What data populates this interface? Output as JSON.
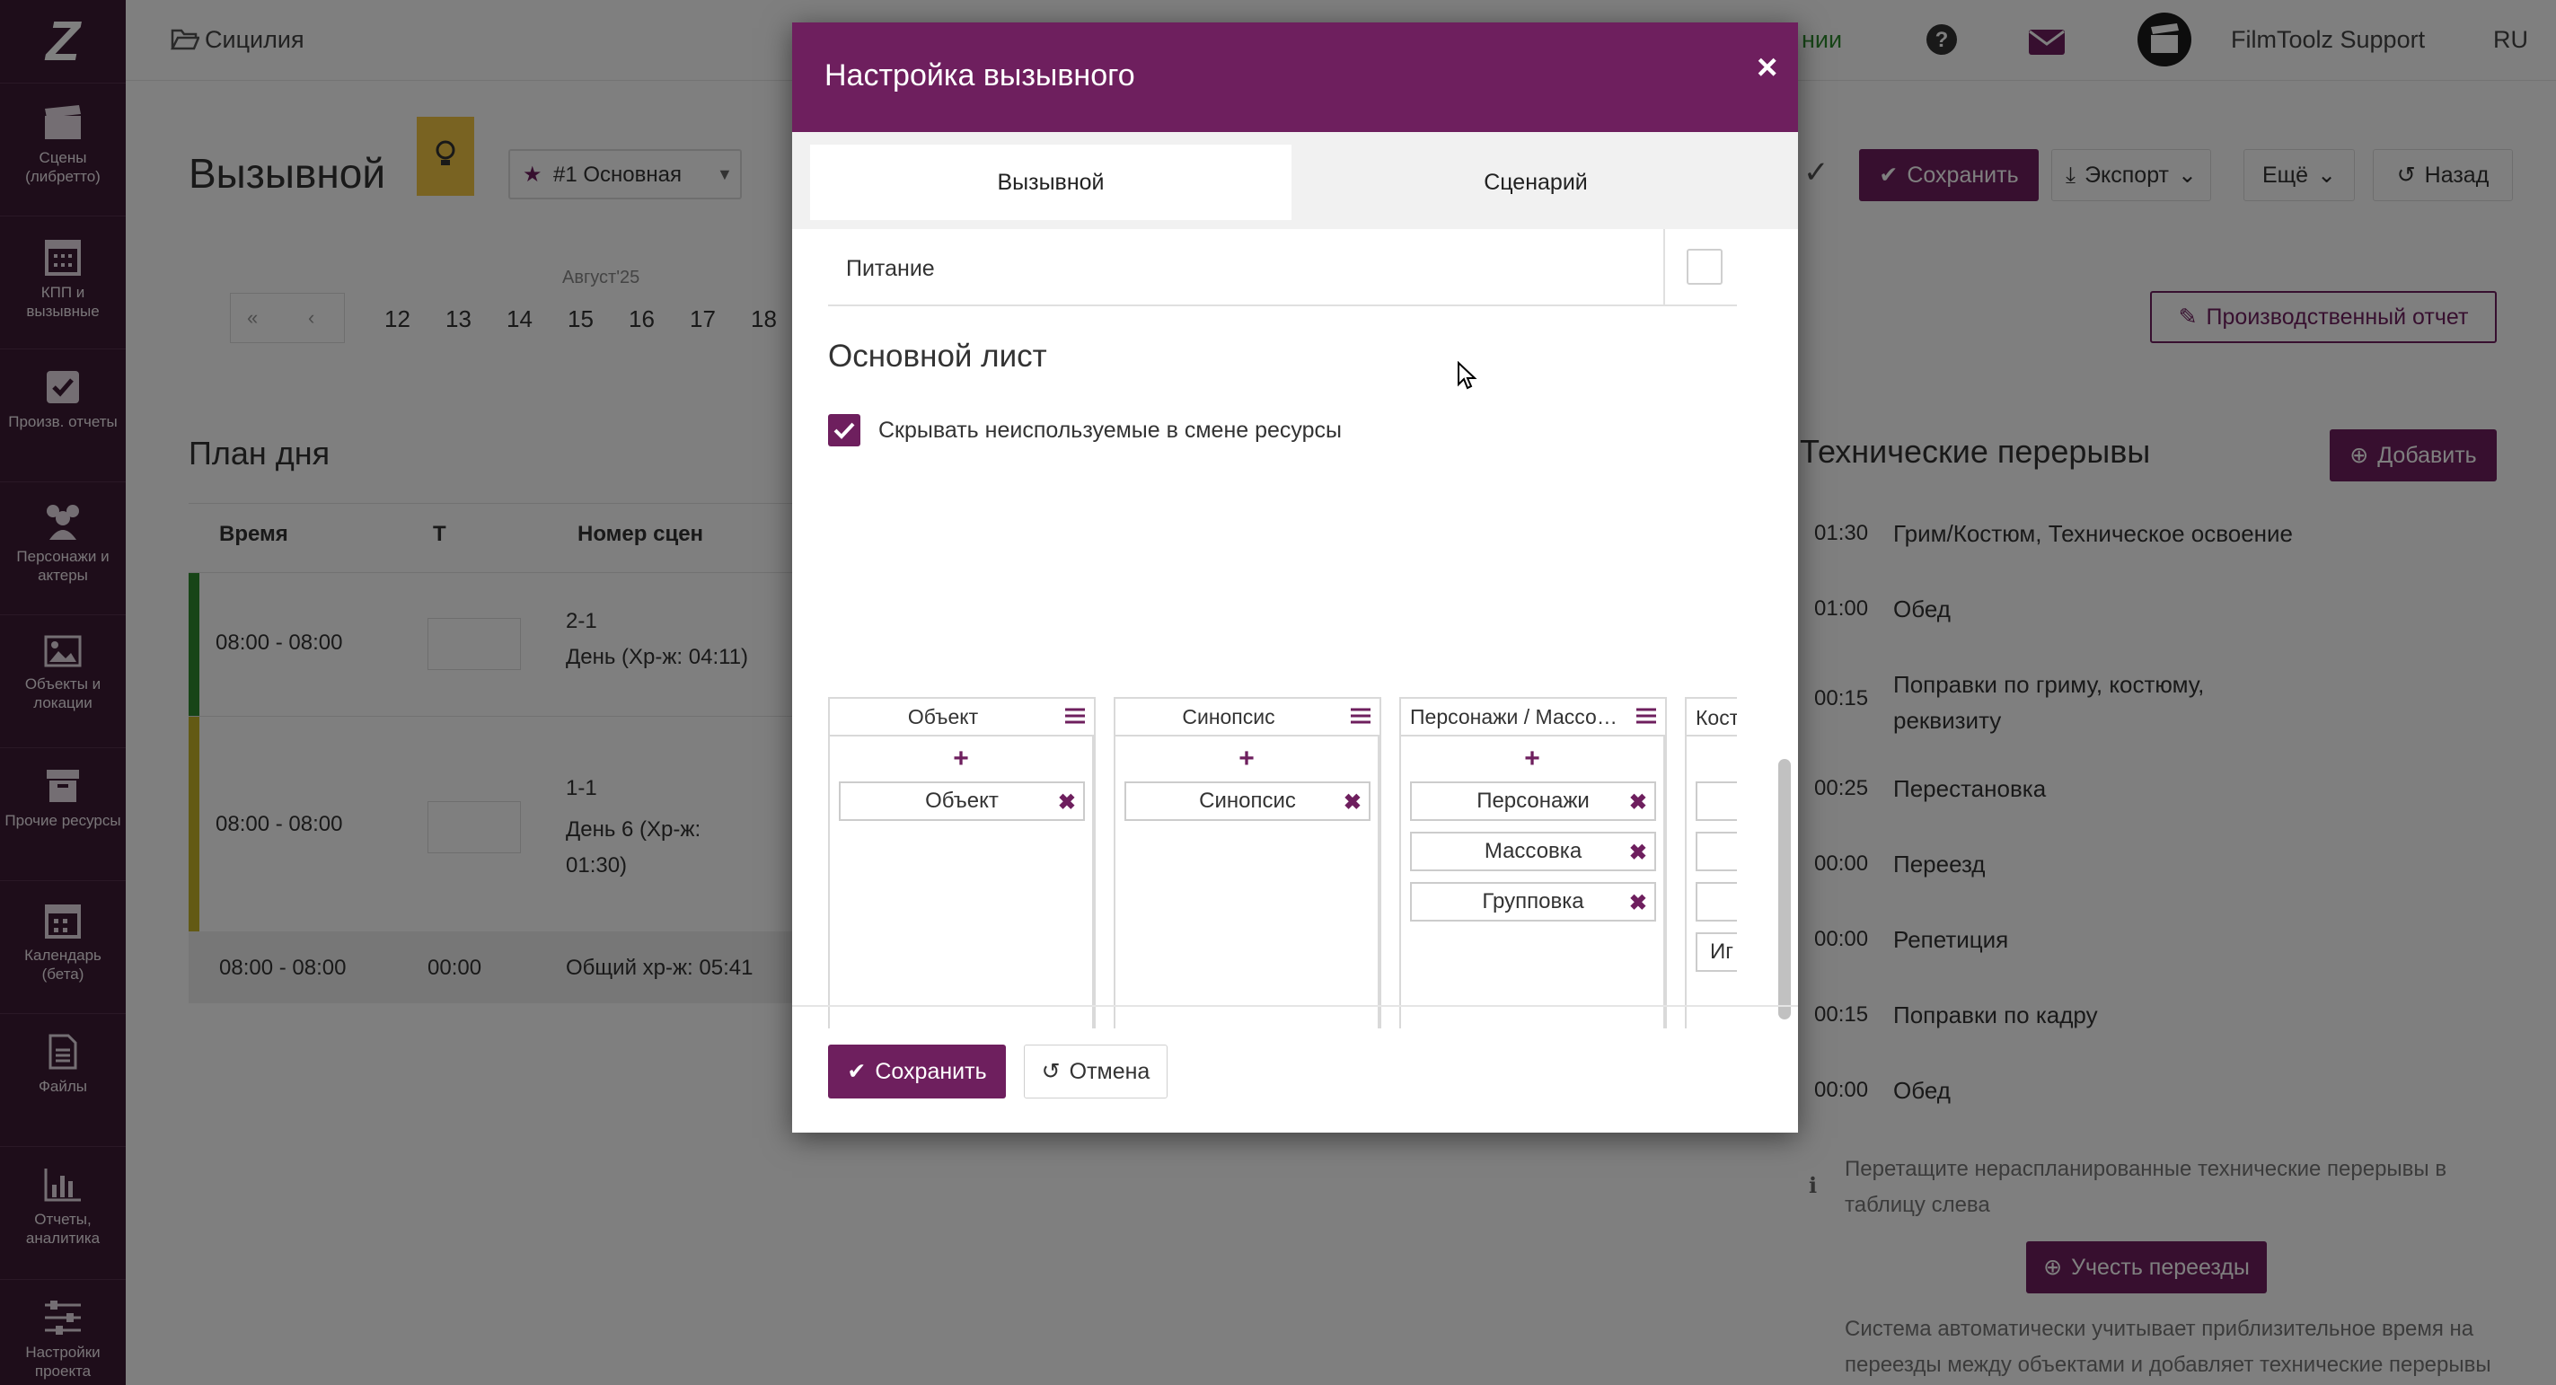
{
  "app": {
    "logo": "Z",
    "sidebar": [
      {
        "label": "Сцены (либретто)",
        "icon": "clapperboard-icon"
      },
      {
        "label": "КПП и вызывные",
        "icon": "calendar-grid-icon"
      },
      {
        "label": "Произв. отчеты",
        "icon": "checkbox-icon"
      },
      {
        "label": "Персонажи и актеры",
        "icon": "users-icon"
      },
      {
        "label": "Объекты и локации",
        "icon": "image-icon"
      },
      {
        "label": "Прочие ресурсы",
        "icon": "archive-icon"
      },
      {
        "label": "Календарь (бета)",
        "icon": "calendar-icon"
      },
      {
        "label": "Файлы",
        "icon": "file-icon"
      },
      {
        "label": "Отчеты, аналитика",
        "icon": "bar-chart-icon"
      },
      {
        "label": "Настройки проекта",
        "icon": "sliders-icon"
      }
    ],
    "topbar": {
      "project": "Сицилия",
      "status_fragment": "нии",
      "user": "FilmToolz Support",
      "lang": "RU"
    }
  },
  "page": {
    "title": "Вызывной",
    "version_select": "#1 Основная",
    "buttons": {
      "save": "Сохранить",
      "export": "Экспорт",
      "more": "Ещё",
      "back": "Назад",
      "production_report": "Производственный отчет",
      "add": "Добавить",
      "account_moves": "Учесть переезды"
    },
    "calendar": {
      "month": "Август'25",
      "days": [
        "12",
        "13",
        "14",
        "15",
        "16",
        "17",
        "18"
      ]
    },
    "plan": {
      "title": "План дня",
      "columns": [
        "Время",
        "Т",
        "Номер сцен"
      ],
      "rows": [
        {
          "time": "08:00 - 08:00",
          "scene": "2-1",
          "desc": "День (Хр-ж: 04:11)",
          "accent": "#2e8b2e"
        },
        {
          "time": "08:00 - 08:00",
          "scene": "1-1",
          "desc": "День 6 (Хр-ж: 01:30)",
          "accent": "#c7b428"
        },
        {
          "time": "08:00 - 08:00",
          "t": "00:00",
          "desc": "Общий хр-ж: 05:41"
        }
      ]
    },
    "breaks": {
      "title": "Технические перерывы",
      "items": [
        {
          "time": "01:30",
          "label": "Грим/Костюм, Техническое освоение"
        },
        {
          "time": "01:00",
          "label": "Обед"
        },
        {
          "time": "00:15",
          "label": "Поправки по гриму, костюму, реквизиту"
        },
        {
          "time": "00:25",
          "label": "Перестановка"
        },
        {
          "time": "00:00",
          "label": "Переезд"
        },
        {
          "time": "00:00",
          "label": "Репетиция"
        },
        {
          "time": "00:15",
          "label": "Поправки по кадру"
        },
        {
          "time": "00:00",
          "label": "Обед"
        }
      ],
      "hint": "Перетащите нераспланированные технические перерывы в таблицу слева",
      "note": "Система автоматически учитывает приблизительное время на переезды между объектами и добавляет технические перерывы"
    }
  },
  "modal": {
    "title": "Настройка вызывного",
    "close": "×",
    "tabs": [
      {
        "label": "Вызывной",
        "active": true
      },
      {
        "label": "Сценарий",
        "active": false
      }
    ],
    "food_row": {
      "label": "Питание",
      "checked": false
    },
    "section_title": "Основной лист",
    "hide_unused": {
      "label": "Скрывать неиспользуемые в смене ресурсы",
      "checked": true
    },
    "columns": [
      {
        "title": "Объект",
        "items": [
          "Объект"
        ]
      },
      {
        "title": "Синопсис",
        "items": [
          "Синопсис"
        ]
      },
      {
        "title": "Персонажи / Массовка / Групповка",
        "items": [
          "Персонажи",
          "Массовка",
          "Групповка"
        ]
      },
      {
        "title": "Кост",
        "items": [
          "",
          "",
          "",
          "Иг"
        ]
      }
    ],
    "add_symbol": "+",
    "remove_symbol": "✖",
    "save": "Сохранить",
    "cancel": "Отмена"
  },
  "colors": {
    "brand": "#6e1f5e",
    "sidebar": "#3c1a34"
  }
}
